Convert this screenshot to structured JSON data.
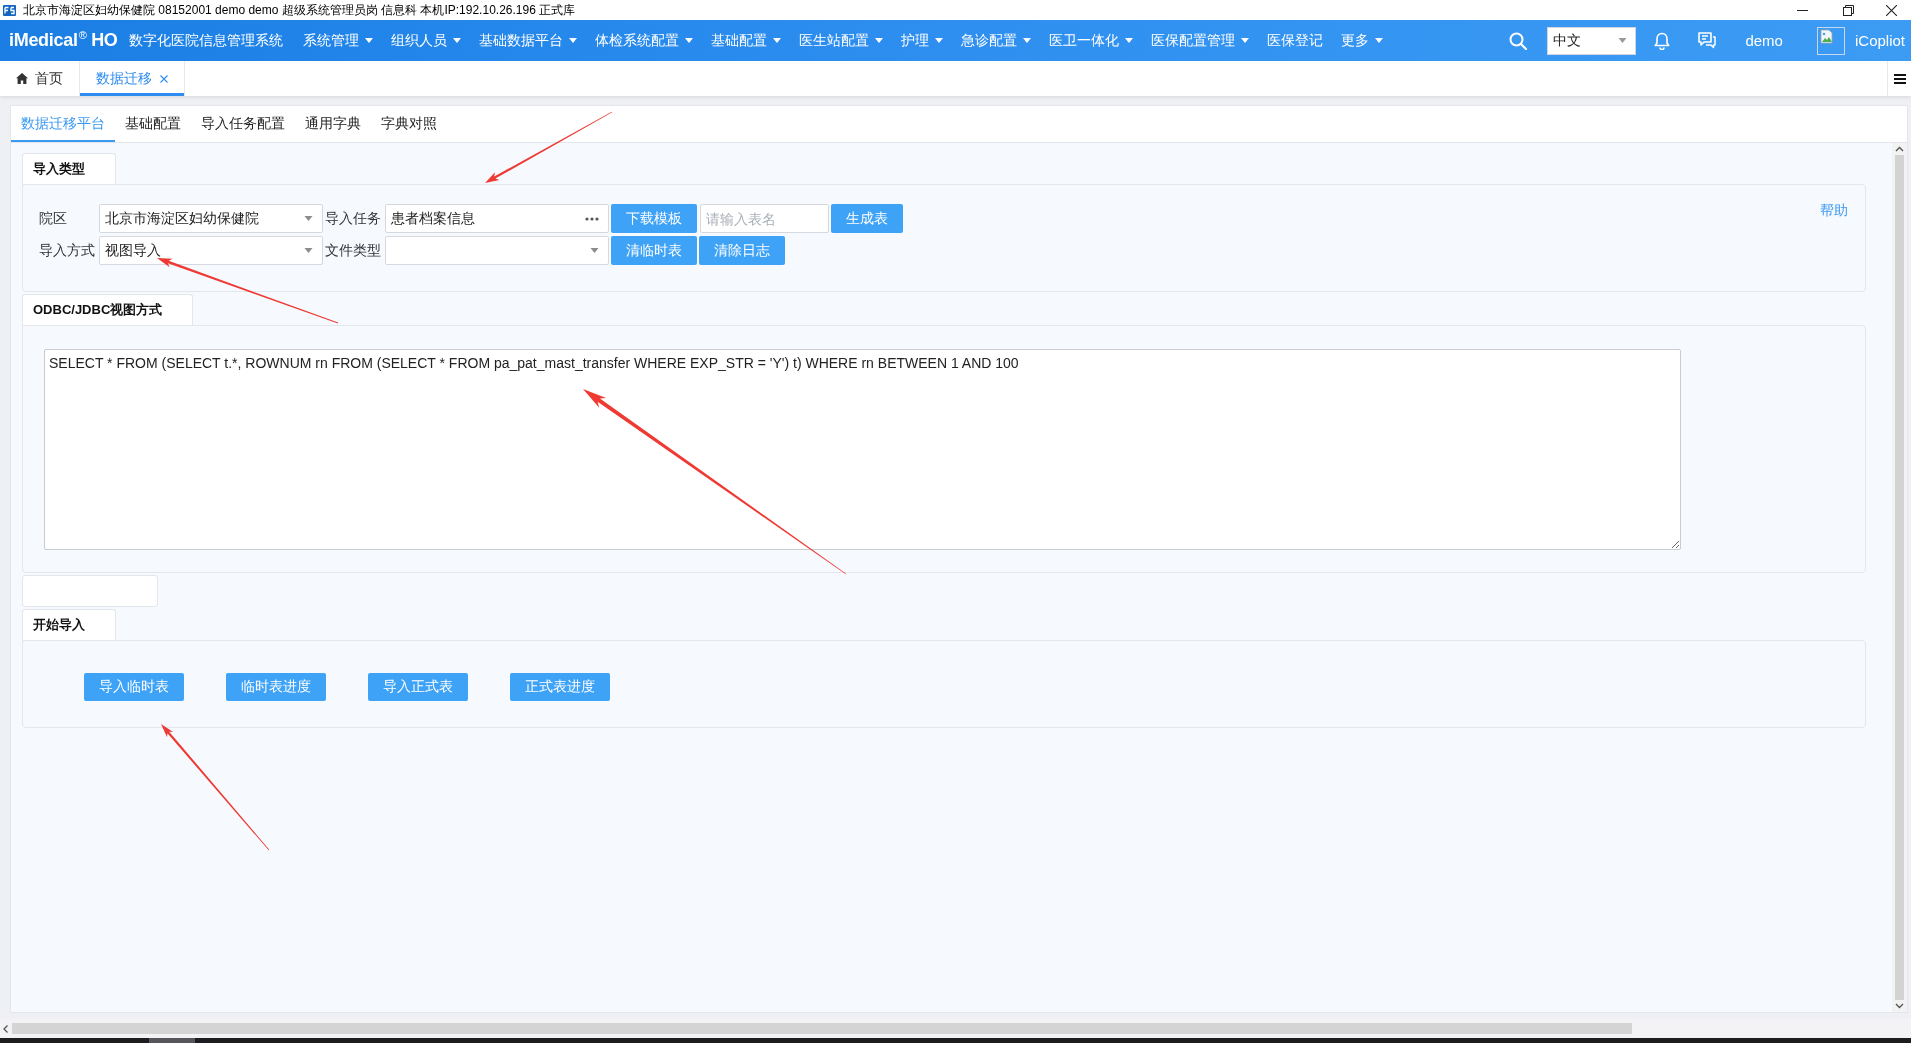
{
  "window": {
    "title": "北京市海淀区妇幼保健院 08152001 demo demo 超级系统管理员岗 信息科 本机IP:192.10.26.196 正式库"
  },
  "top_nav": {
    "logo": "iMedical$^{®}$ HO",
    "system_name": "数字化医院信息管理系统",
    "menus": [
      {
        "label": "系统管理",
        "has_dropdown": true
      },
      {
        "label": "组织人员",
        "has_dropdown": true
      },
      {
        "label": "基础数据平台",
        "has_dropdown": true
      },
      {
        "label": "体检系统配置",
        "has_dropdown": true
      },
      {
        "label": "基础配置",
        "has_dropdown": true
      },
      {
        "label": "医生站配置",
        "has_dropdown": true
      },
      {
        "label": "护理",
        "has_dropdown": true
      },
      {
        "label": "急诊配置",
        "has_dropdown": true
      },
      {
        "label": "医卫一体化",
        "has_dropdown": true
      },
      {
        "label": "医保配置管理",
        "has_dropdown": true
      },
      {
        "label": "医保登记",
        "has_dropdown": false
      },
      {
        "label": "更多",
        "has_dropdown": true
      }
    ],
    "language": "中文",
    "user": "demo",
    "assistant": "iCopliot"
  },
  "page_tabs": [
    {
      "label": "首页",
      "kind": "home",
      "selected": false
    },
    {
      "label": "数据迁移",
      "kind": "closable",
      "selected": true
    }
  ],
  "sub_tabs": [
    {
      "label": "数据迁移平台",
      "selected": true
    },
    {
      "label": "基础配置",
      "selected": false
    },
    {
      "label": "导入任务配置",
      "selected": false
    },
    {
      "label": "通用字典",
      "selected": false
    },
    {
      "label": "字典对照",
      "selected": false
    }
  ],
  "import_type": {
    "heading": "导入类型",
    "rows": [
      {
        "items": [
          {
            "kind": "label",
            "text": "院区"
          },
          {
            "kind": "select",
            "value": "北京市海淀区妇幼保健院"
          },
          {
            "kind": "label",
            "text": "导入任务"
          },
          {
            "kind": "lookup",
            "value": "患者档案信息"
          },
          {
            "kind": "button",
            "label": "下载模板"
          },
          {
            "kind": "input",
            "placeholder": "请输入表名"
          },
          {
            "kind": "button",
            "label": "生成表"
          }
        ]
      },
      {
        "items": [
          {
            "kind": "label",
            "text": "导入方式"
          },
          {
            "kind": "select",
            "value": "视图导入"
          },
          {
            "kind": "label",
            "text": "文件类型"
          },
          {
            "kind": "select"
          },
          {
            "kind": "button",
            "label": "清临时表"
          },
          {
            "kind": "button",
            "label": "清除日志"
          }
        ]
      }
    ],
    "help_link": "帮助"
  },
  "view_mode": {
    "heading": "ODBC/JDBC视图方式",
    "sql": "SELECT * FROM (SELECT t.*, ROWNUM rn FROM (SELECT * FROM pa_pat_mast_transfer WHERE EXP_STR = 'Y') t) WHERE rn BETWEEN 1 AND 100"
  },
  "start_import": {
    "heading": "开始导入",
    "buttons": [
      "导入临时表",
      "临时表进度",
      "导入正式表",
      "正式表进度"
    ]
  }
}
